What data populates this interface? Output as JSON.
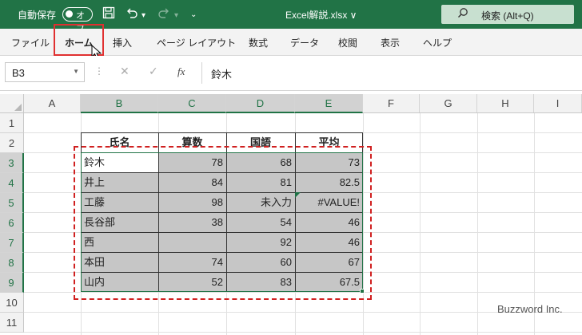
{
  "titlebar": {
    "autosave_label": "自動保存",
    "toggle_label": "オフ",
    "save_icon": "save-icon",
    "undo_icon": "undo-icon",
    "redo_icon": "redo-icon",
    "customize_icon": "chevron-down-icon",
    "filename": "Excel解説.xlsx ∨",
    "search_placeholder": "検索 (Alt+Q)",
    "accent_color": "#217346"
  },
  "ribbon": {
    "tabs": [
      "ファイル",
      "ホーム",
      "挿入",
      "ページ レイアウト",
      "数式",
      "データ",
      "校閲",
      "表示",
      "ヘルプ"
    ],
    "active_tab": "ホーム",
    "highlight_color": "#e03030"
  },
  "formula_bar": {
    "name_box": "B3",
    "cancel_icon": "close-icon",
    "enter_icon": "check-icon",
    "fx_label": "fx",
    "value": "鈴木"
  },
  "columns": [
    "A",
    "B",
    "C",
    "D",
    "E",
    "F",
    "G",
    "H",
    "I"
  ],
  "rows": [
    "1",
    "2",
    "3",
    "4",
    "5",
    "6",
    "7",
    "8",
    "9",
    "10",
    "11"
  ],
  "table": {
    "headers": [
      "氏名",
      "算数",
      "国語",
      "平均"
    ],
    "rows": [
      [
        "鈴木",
        "78",
        "68",
        "73"
      ],
      [
        "井上",
        "84",
        "81",
        "82.5"
      ],
      [
        "工藤",
        "98",
        "未入力",
        "#VALUE!"
      ],
      [
        "長谷部",
        "38",
        "54",
        "46"
      ],
      [
        "西",
        "",
        "92",
        "46"
      ],
      [
        "本田",
        "74",
        "60",
        "67"
      ],
      [
        "山内",
        "52",
        "83",
        "67.5"
      ]
    ]
  },
  "watermark": "Buzzword Inc."
}
